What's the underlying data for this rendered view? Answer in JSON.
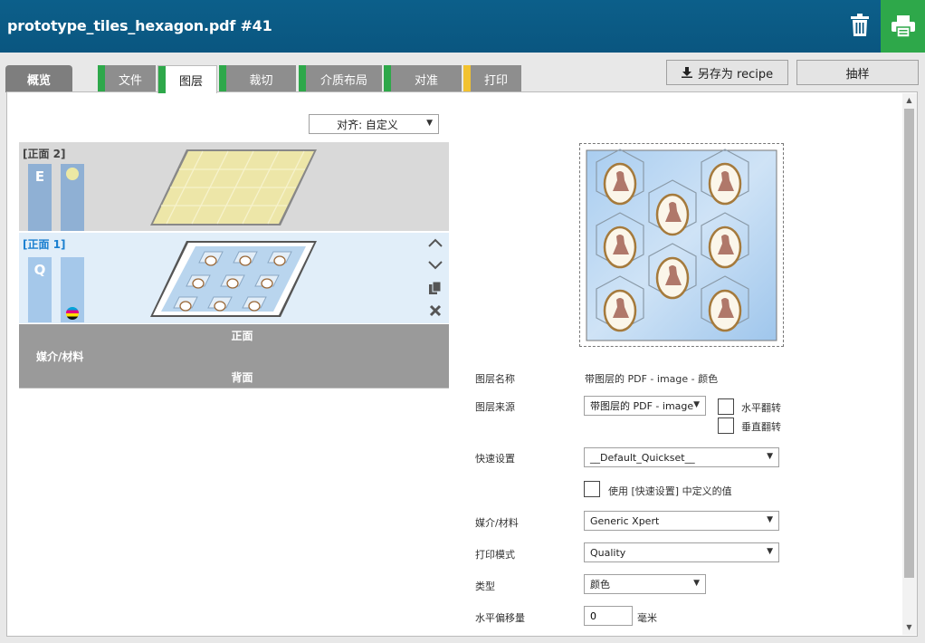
{
  "window": {
    "title": "prototype_tiles_hexagon.pdf #41",
    "trash_icon": "trash-icon",
    "print_icon": "printer-icon"
  },
  "colors": {
    "titlebar": "#0a5680",
    "print_button": "#2ea84a",
    "tab_green": "#2ea84a",
    "tab_yellow": "#f2c230",
    "selected_layer_text": "#1a7fd0"
  },
  "tabs": [
    {
      "label": "概览"
    },
    {
      "label": "文件"
    },
    {
      "label": "图层"
    },
    {
      "label": "裁切"
    },
    {
      "label": "介质布局"
    },
    {
      "label": "对准"
    },
    {
      "label": "打印"
    }
  ],
  "toolbar": {
    "save_recipe_label": "另存为 recipe",
    "sample_label": "抽样"
  },
  "align": {
    "label": "对齐: 自定义"
  },
  "layers": [
    {
      "label": "[正面 2]",
      "ink_letter": "E"
    },
    {
      "label": "[正面 1]",
      "ink_letter": "Q"
    }
  ],
  "media_band": {
    "front": "正面",
    "media": "媒介/材料",
    "back": "背面"
  },
  "form": {
    "layer_name_label": "图层名称",
    "layer_name_value": "带图层的 PDF - image - 颜色",
    "layer_source_label": "图层来源",
    "layer_source_value": "带图层的 PDF - image",
    "flip_h_label": "水平翻转",
    "flip_v_label": "垂直翻转",
    "quickset_label": "快速设置",
    "quickset_value": "__Default_Quickset__",
    "use_quickset_label": "使用 [快速设置] 中定义的值",
    "media_label": "媒介/材料",
    "media_value": "Generic Xpert",
    "print_mode_label": "打印模式",
    "print_mode_value": "Quality",
    "type_label": "类型",
    "type_value": "颜色",
    "h_offset_label": "水平偏移量",
    "h_offset_value": "0",
    "h_offset_unit": "毫米"
  }
}
